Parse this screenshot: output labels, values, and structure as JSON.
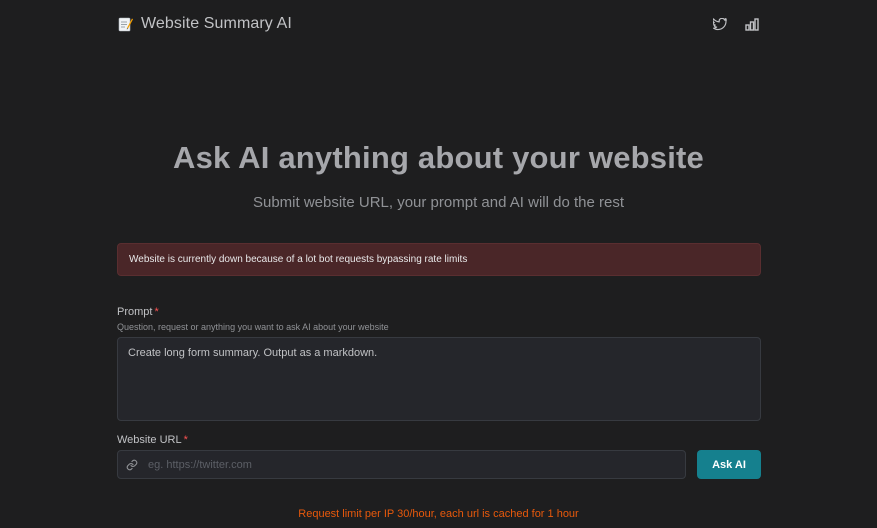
{
  "header": {
    "title": "Website Summary AI",
    "brand_icon": "memo-icon",
    "actions": [
      "twitter-icon",
      "bar-chart-icon"
    ]
  },
  "hero": {
    "title": "Ask AI anything about your website",
    "subtitle": "Submit website URL, your prompt and AI will do the rest"
  },
  "alert": {
    "text": "Website is currently down because of a lot bot requests bypassing rate limits",
    "color": "#4a2628"
  },
  "form": {
    "prompt": {
      "label": "Prompt",
      "required_mark": "*",
      "description": "Question, request or anything you want to ask AI about your website",
      "value": "Create long form summary. Output as a markdown."
    },
    "url": {
      "label": "Website URL",
      "required_mark": "*",
      "placeholder": "eg. https://twitter.com",
      "value": "",
      "icon": "link-icon"
    },
    "submit_label": "Ask AI"
  },
  "footer": {
    "note": "Request limit per IP 30/hour, each url is cached for 1 hour"
  },
  "colors": {
    "accent": "#15808e",
    "warning_text": "#e8590c",
    "required": "#fa5252",
    "background": "#1e1e1f"
  }
}
